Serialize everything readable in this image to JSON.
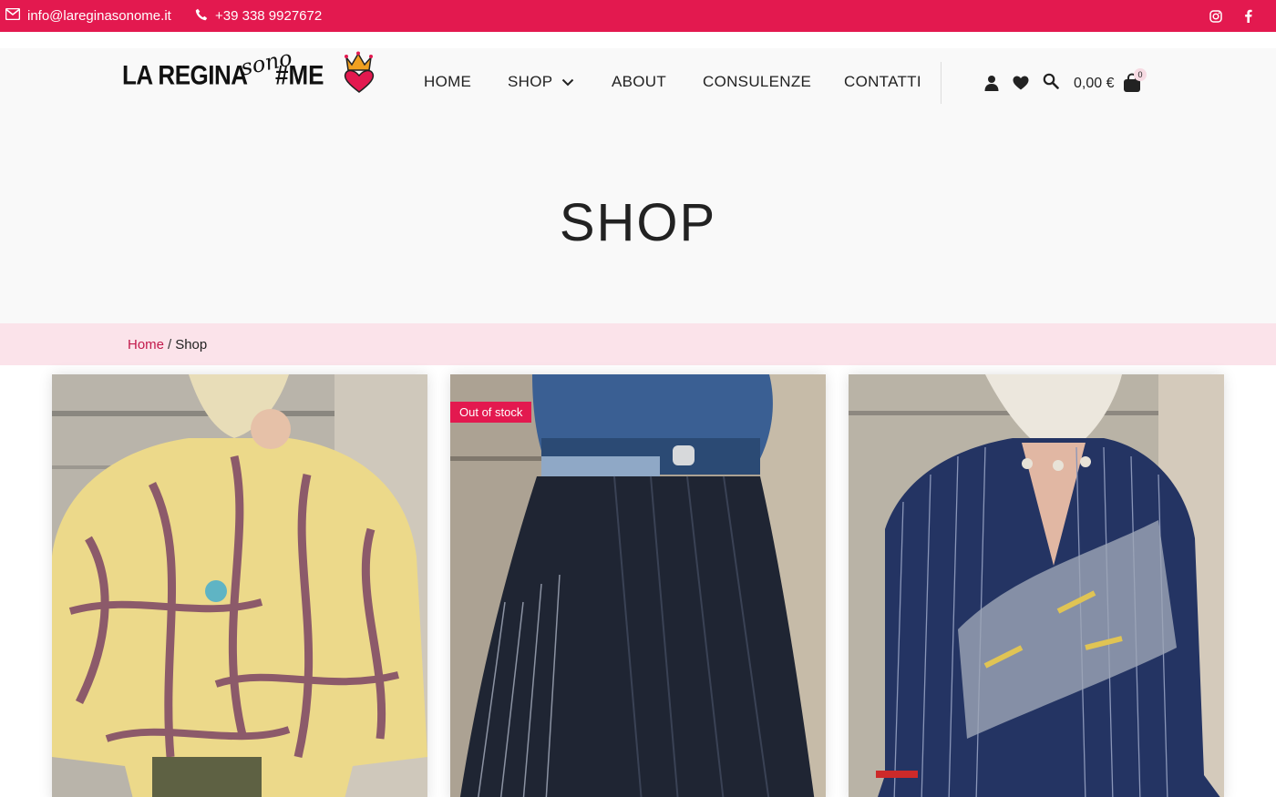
{
  "topbar": {
    "email": "info@lareginasonome.it",
    "phone": "+39 338 9927672",
    "icons": [
      "envelope-icon",
      "phone-icon",
      "instagram-icon",
      "facebook-icon"
    ],
    "color": "#e3194f"
  },
  "logo": {
    "part1": "LA REGINA",
    "part2": "sono",
    "part3": "#ME"
  },
  "nav": {
    "home": "HOME",
    "shop": "SHOP",
    "about": "ABOUT",
    "consulenze": "CONSULENZE",
    "contatti": "CONTATTI"
  },
  "header_actions": {
    "cart_total": "0,00 €",
    "cart_count": "0",
    "icons": [
      "user-icon",
      "heart-icon",
      "search-icon",
      "shopping-bag-icon"
    ]
  },
  "page": {
    "title": "SHOP"
  },
  "breadcrumb": {
    "home": "Home",
    "separator": "/",
    "current": "Shop"
  },
  "products": [
    {
      "badge": ""
    },
    {
      "badge": "Out of stock"
    },
    {
      "badge": ""
    }
  ],
  "colors": {
    "accent": "#e3194f",
    "breadcrumb_bg": "#fbe3ea",
    "header_bg": "#f9f9f9"
  }
}
